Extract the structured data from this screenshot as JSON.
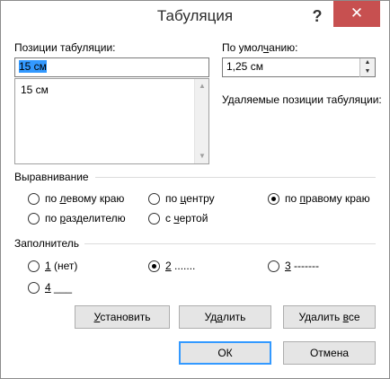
{
  "window": {
    "title": "Табуляция",
    "help_glyph": "?",
    "close_glyph": "✕"
  },
  "tab_positions": {
    "label": "Позиции табуляции:",
    "value": "15 см",
    "list": [
      "15 см"
    ]
  },
  "default_stops": {
    "label_before": "По умол",
    "label_underlined": "ч",
    "label_after": "анию:",
    "value": "1,25 см"
  },
  "clear_positions_label": "Удаляемые позиции табуляции:",
  "alignment": {
    "label": "Выравнивание",
    "options": [
      {
        "pre": "по ",
        "u": "л",
        "post": "евому краю",
        "checked": false
      },
      {
        "pre": "по ",
        "u": "ц",
        "post": "ентру",
        "checked": false
      },
      {
        "pre": "по ",
        "u": "п",
        "post": "равому краю",
        "checked": true
      },
      {
        "pre": "по ",
        "u": "р",
        "post": "азделителю",
        "checked": false
      },
      {
        "pre": "с ",
        "u": "ч",
        "post": "ертой",
        "checked": false
      }
    ]
  },
  "leader": {
    "label": "Заполнитель",
    "options": [
      {
        "u": "1",
        "post": " (нет)",
        "checked": false
      },
      {
        "u": "2",
        "post": " .......",
        "checked": true
      },
      {
        "u": "3",
        "post": " -------",
        "checked": false
      },
      {
        "u": "4",
        "post": " ___",
        "checked": false
      }
    ]
  },
  "buttons": {
    "set": {
      "u": "У",
      "post": "становить"
    },
    "clear": {
      "pre": "Уд",
      "u": "а",
      "post": "лить"
    },
    "clear_all": {
      "pre": "Удалить ",
      "u": "в",
      "post": "се"
    },
    "ok": "ОК",
    "cancel": "Отмена"
  },
  "colors": {
    "close_button": "#c75050",
    "selection": "#3399ff"
  }
}
